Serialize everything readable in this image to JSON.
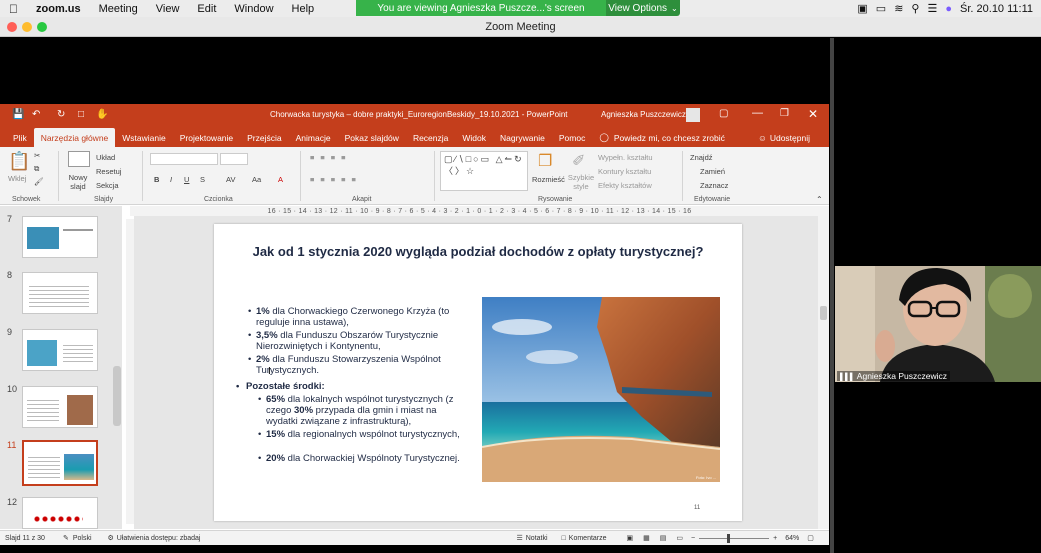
{
  "menubar": {
    "app": "zoom.us",
    "items": [
      "Meeting",
      "View",
      "Edit",
      "Window",
      "Help"
    ],
    "banner": "You are viewing Agnieszka Puszcze...'s screen",
    "view_options": "View Options",
    "clock": "Śr. 20.10  11:11"
  },
  "zoom": {
    "title": "Zoom Meeting"
  },
  "ppt": {
    "title": "Chorwacka turystyka – dobre praktyki_EuroregionBeskidy_19.10.2021  -  PowerPoint",
    "user": "Agnieszka Puszczewicz",
    "tabs": [
      "Plik",
      "Narzędzia główne",
      "Wstawianie",
      "Projektowanie",
      "Przejścia",
      "Animacje",
      "Pokaz slajdów",
      "Recenzja",
      "Widok",
      "Nagrywanie",
      "Pomoc"
    ],
    "tell_me": "Powiedz mi, co chcesz zrobić",
    "share": "Udostępnij",
    "ribbon": {
      "paste": "Wklej",
      "new_slide": "Nowy slajd",
      "layout": "Układ",
      "reset": "Resetuj",
      "section": "Sekcja",
      "arrange": "Rozmieść",
      "quick_styles": "Szybkie style",
      "fill": "Wypełn. kształtu",
      "outline": "Kontury kształtu",
      "effects": "Efekty kształtów",
      "find": "Znajdź",
      "replace": "Zamień",
      "select": "Zaznacz",
      "groups": [
        "Schowek",
        "Slajdy",
        "Czcionka",
        "Akapit",
        "Rysowanie",
        "Edytowanie"
      ]
    },
    "ruler": "16 · 15 · 14 · 13 · 12 · 11 · 10 · 9 · 8 · 7 · 6 · 5 · 4 · 3 · 2 · 1 · 0 · 1 · 2 · 3 · 4 · 5 · 6 · 7 · 8 · 9 · 10 · 11 · 12 · 13 · 14 · 15 · 16",
    "thumb_numbers": [
      "7",
      "8",
      "9",
      "10",
      "11",
      "12"
    ],
    "slide": {
      "title": "Jak od 1 stycznia 2020 wygląda podział dochodów z opłaty turystycznej?",
      "b1_pct": "1%",
      "b1_text": " dla Chorwackiego Czerwonego Krzyża (to reguluje inna ustawa),",
      "b2_pct": "3,5%",
      "b2_text": " dla Funduszu Obszarów Turystycznie Nierozwiniętych i Kontynentu,",
      "b3_pct": "2%",
      "b3_text": " dla Funduszu Stowarzyszenia Wspólnot Turystycznych.",
      "rest": "Pozostałe środki:",
      "c1_pct": "65%",
      "c1_a": " dla lokalnych wspólnot turystycznych (z czego ",
      "c1_pct2": "30%",
      "c1_b": " przypada dla gmin i miast na wydatki związane z infrastrukturą),",
      "c2_pct": "15%",
      "c2_text": " dla regionalnych wspólnot turystycznych,",
      "c3_pct": "20%",
      "c3_text": " dla Chorwackiej Wspólnoty Turystycznej.",
      "photo_credit": "Foto: Ivo ...",
      "number": "11"
    },
    "status": {
      "slide": "Slajd 11 z 30",
      "language": "Polski",
      "accessibility": "Ułatwienia dostępu: zbadaj",
      "notes": "Notatki",
      "comments": "Komentarze",
      "zoom": "64%"
    }
  },
  "webcam": {
    "name": "Agnieszka Puszczewicz"
  },
  "colors": {
    "ppt_accent": "#c43e1c",
    "zoom_green": "#37b34a"
  }
}
